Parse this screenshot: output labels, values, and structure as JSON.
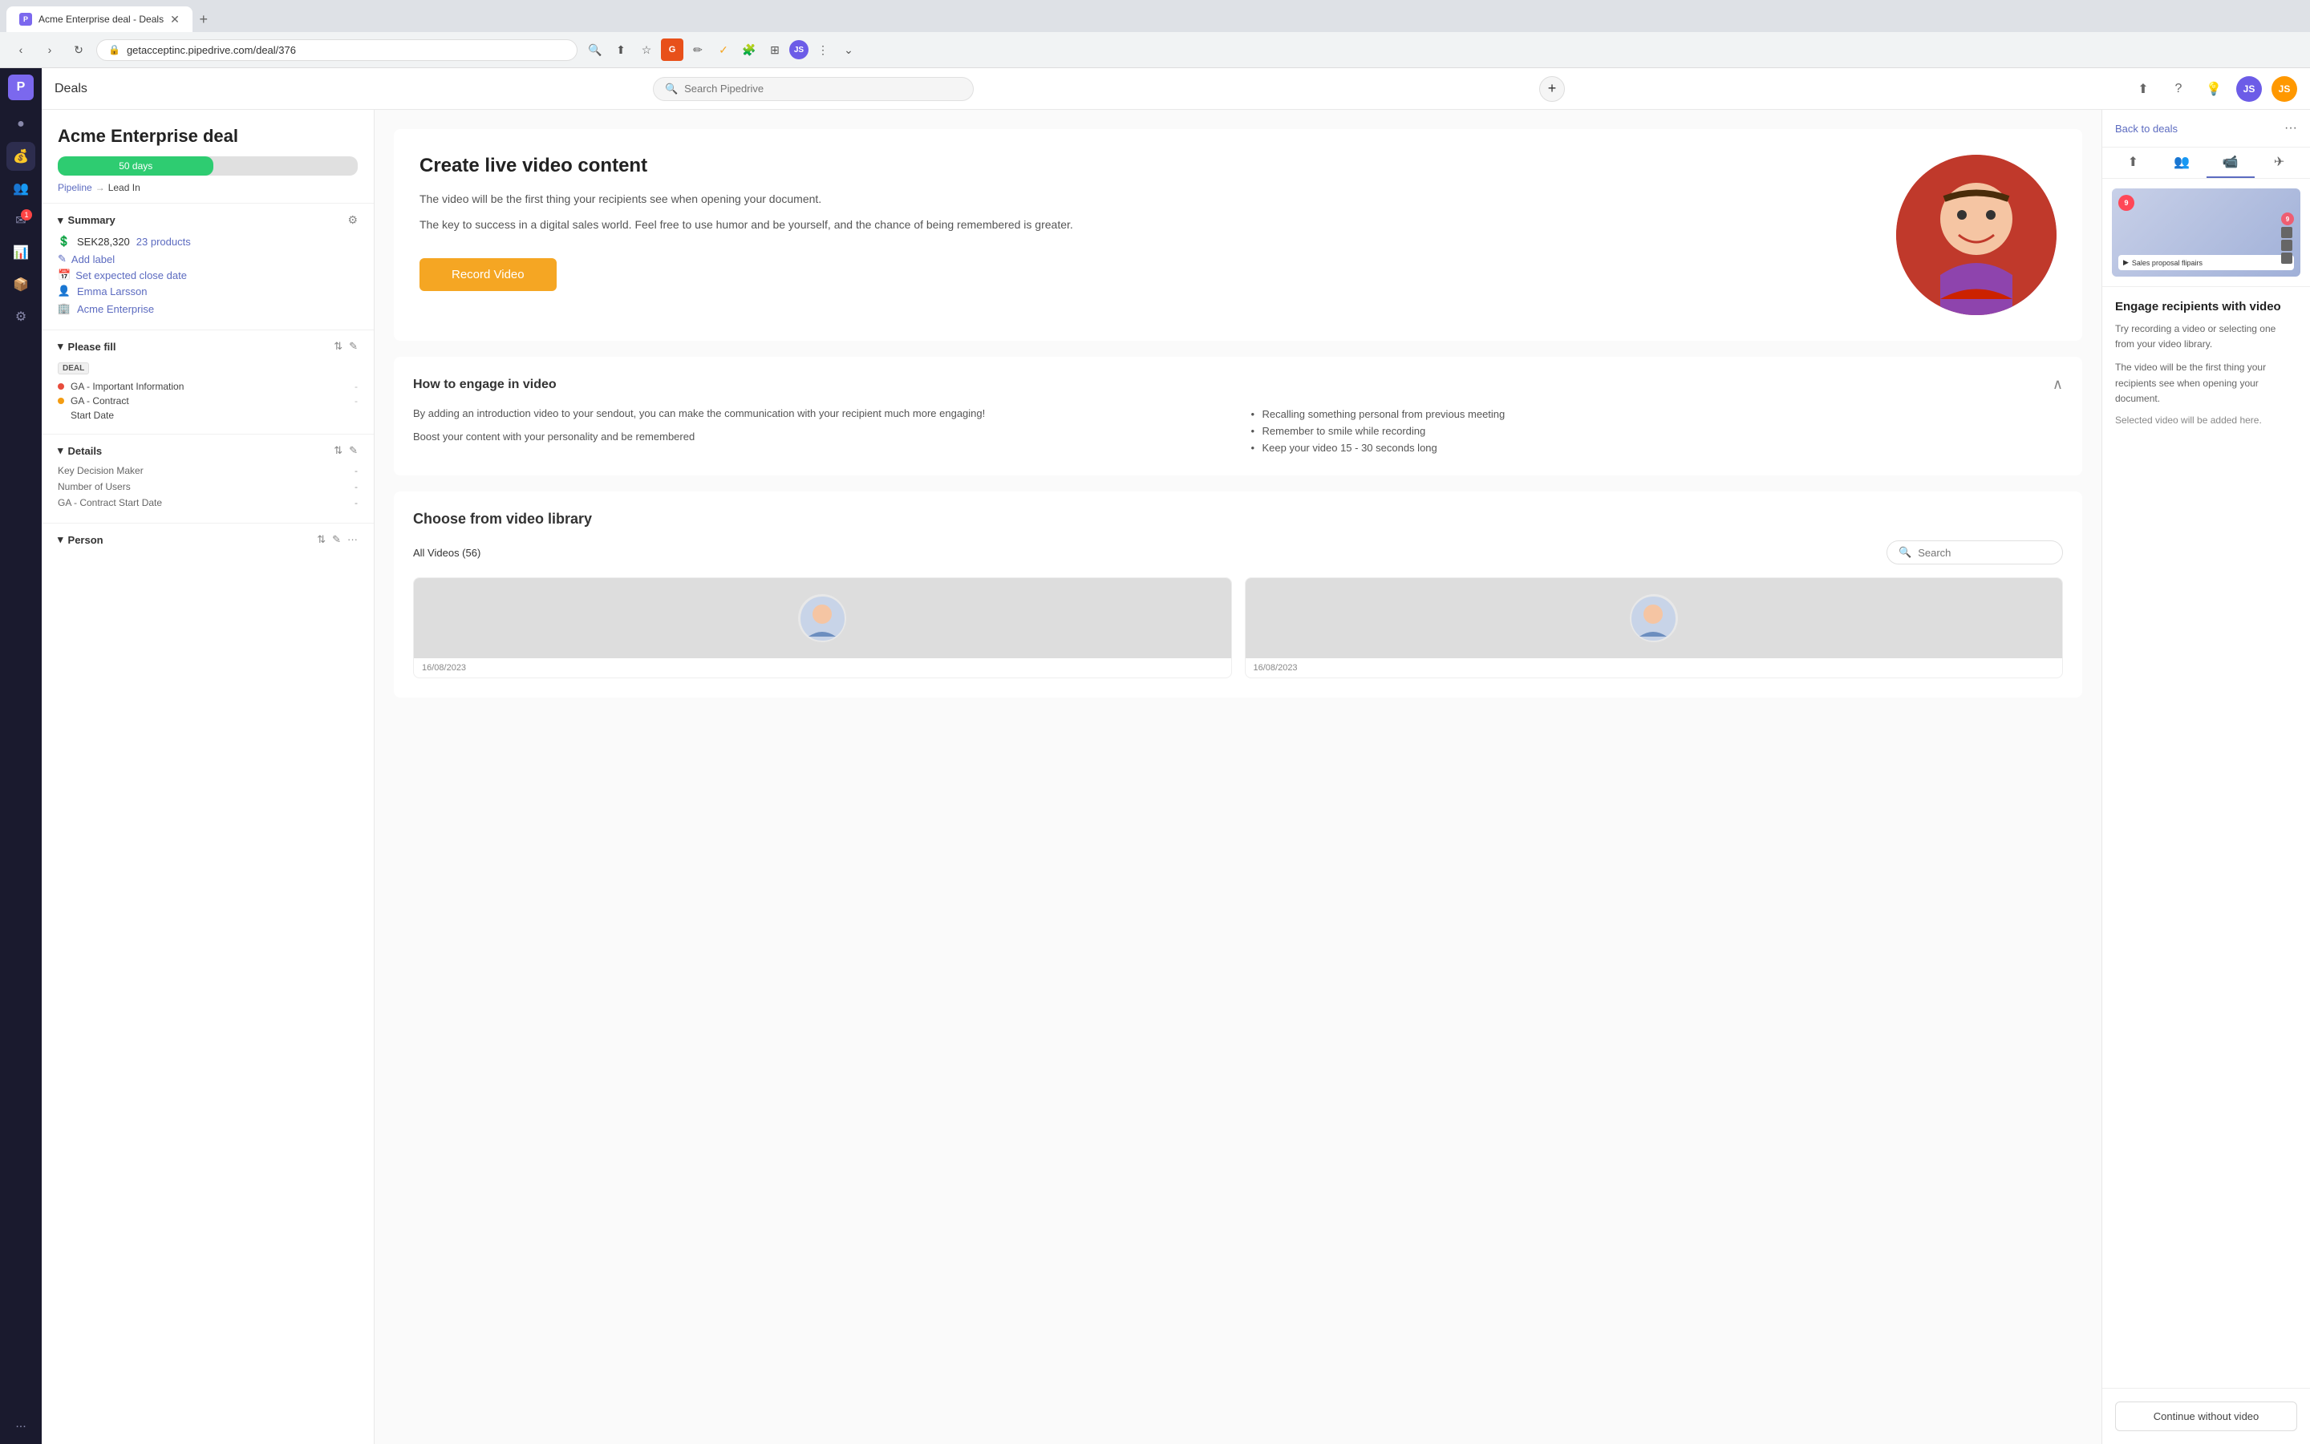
{
  "browser": {
    "tab_title": "Acme Enterprise deal - Deals",
    "tab_favicon": "P",
    "address": "getacceptinc.pipedrive.com/deal/376",
    "new_tab_icon": "+"
  },
  "top_bar": {
    "title": "Deals",
    "search_placeholder": "Search Pipedrive",
    "add_icon": "+",
    "user_initials": "JS",
    "user_initials_orange": "JS"
  },
  "sidebar": {
    "logo": "P",
    "icons": [
      "●",
      "💰",
      "👥",
      "✉",
      "📊",
      "📦",
      "🔧",
      "⚙"
    ],
    "notification_count": "1",
    "more_label": "..."
  },
  "left_panel": {
    "deal_title": "Acme Enterprise deal",
    "progress_days": "50 days",
    "progress_width": "52%",
    "breadcrumb_pipeline": "Pipeline",
    "breadcrumb_separator": "→",
    "breadcrumb_current": "Lead In",
    "summary": {
      "title": "Summary",
      "amount": "SEK28,320",
      "products_count": "23 products",
      "add_label_link": "Add label",
      "close_date_link": "Set expected close date",
      "person_name": "Emma Larsson",
      "company_name": "Acme Enterprise"
    },
    "please_fill": {
      "title": "Please fill",
      "deal_badge": "DEAL",
      "fields": [
        {
          "color": "red",
          "name": "GA - Important Information",
          "value": "-"
        },
        {
          "color": "yellow",
          "name": "GA - Contract Start Date",
          "value": "-"
        }
      ]
    },
    "details": {
      "title": "Details",
      "rows": [
        {
          "label": "Key Decision Maker",
          "value": "-"
        },
        {
          "label": "Number of Users",
          "value": "-"
        },
        {
          "label": "GA - Contract Start Date",
          "value": "-"
        }
      ]
    },
    "person": {
      "title": "Person"
    }
  },
  "center_panel": {
    "video_create": {
      "title": "Create live video content",
      "desc1": "The video will be the first thing your recipients see when opening your document.",
      "desc2": "The key to success in a digital sales world. Feel free to use humor and be yourself, and the chance of being remembered is greater.",
      "record_btn_label": "Record Video"
    },
    "engage": {
      "title": "How to engage in video",
      "left_text1": "By adding an introduction video to your sendout, you can make the communication with your recipient much more engaging!",
      "left_text2": "Boost your content with your personality and be remembered",
      "tips": [
        "Recalling something personal from previous meeting",
        "Remember to smile while recording",
        "Keep your video 15 - 30 seconds long"
      ]
    },
    "library": {
      "title": "Choose from video library",
      "filter_label": "All Videos (56)",
      "search_placeholder": "Search",
      "videos": [
        {
          "date": "16/08/2023"
        },
        {
          "date": "16/08/2023"
        }
      ]
    }
  },
  "right_panel": {
    "back_label": "Back to deals",
    "dots": "···",
    "tabs": [
      "upload",
      "people",
      "video",
      "send"
    ],
    "preview_play": "▶",
    "preview_badge": "9",
    "preview_title_text": "Sales proposal flipairs",
    "section_title": "Engage recipients with video",
    "desc1": "Try recording a video or selecting one from your video library.",
    "desc2": "The video will be the first thing your recipients see when opening your document.",
    "selected_note": "Selected video will be added here.",
    "continue_btn_label": "Continue without video"
  }
}
